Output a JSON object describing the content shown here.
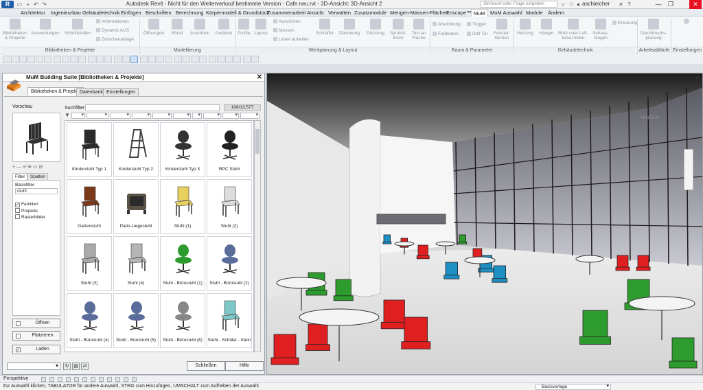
{
  "titlebar": {
    "app_logo": "R",
    "title": "Autodesk Revit - Nicht für den Weiterverkauf bestimmte Version -   Cafe neu.rvt - 3D-Ansicht: 3D-Ansicht 2",
    "search_placeholder": "Stichwort oder Frage eingeben",
    "user": "aschleicher"
  },
  "ribbon": {
    "tabs": [
      "Architektur",
      "Ingenieurbau",
      "Gebäudetechnik",
      "Einfügen",
      "Beschriften",
      "Berechnung",
      "Körpermodell & Grundstück",
      "Zusammenarbeit",
      "Ansicht",
      "Verwalten",
      "Zusatzmodule",
      "Mengen-Massen-Flächen",
      "Enscape™",
      "MuM",
      "MuM Auswahl",
      "Module",
      "Ändern"
    ],
    "active_tab": "MuM",
    "buttons": {
      "bibliotheken": "Bibliotheken & Projekte",
      "auswertungen": "Auswertungen",
      "schnittstellen": "Schnittstellen",
      "informationen": "Informationen",
      "dynamic_aus": "Dynamic AUS",
      "zwischenablage": "Zwischenablage",
      "oeffnungen": "Öffnungen",
      "wand": "Wand",
      "anordnen": "Anordnen",
      "gelaende": "Gelände",
      "profile": "Profile",
      "layout": "Layout",
      "aussichten": "Aussichten",
      "messen": "Messen",
      "linien_aufteilen": "Linien aufteilen",
      "schraffur": "Schraffur",
      "daemmung": "Dämmung",
      "dichtung": "Dichtung",
      "symbol_linien": "Symbol-linien",
      "text_an_flaeche": "Text an Fläche",
      "abwicklung": "Abwicklung",
      "fussboden": "Fußboden",
      "trigger": "Trigger",
      "din_tuer": "DIN Tür",
      "fensterflaechen": "Fenster-flächen",
      "heizung": "Heizung",
      "haenger": "Hänger",
      "rohr_luftkanal": "Rohr oder Luft-kanal teilen",
      "schussfaengen": "Schuss-fängen",
      "kreuzung": "Kreuzung",
      "durchbruchsplanung": "Durchbruchs-planung"
    },
    "panels": [
      "Bibliotheken & Projekte",
      "Modellierung",
      "Werkplanung & Layout",
      "Raum & Parameter",
      "Gebäudetechnik",
      "Arbeitsabläufe",
      "Einstellungen"
    ]
  },
  "colors": {
    "accent": "#1f5da6",
    "chair_red": "#e02020",
    "chair_green": "#2e9b2e",
    "chair_blue": "#1e8fc2",
    "close_red": "#e81123"
  },
  "mum": {
    "title": "MuM Building Suite [Bibliotheken & Projekte]",
    "tabs": [
      "Bibliotheken & Projekte",
      "Datenbank",
      "Einstellungen"
    ],
    "preview_label": "Vorschau",
    "preview_tools": "+ — +⁄ ⊕ ▭ ⊟",
    "filter_tabs": [
      "Filter",
      "Spalten"
    ],
    "basisfilter_label": "Basisfilter",
    "basisfilter_value": "stuhl",
    "checkboxes": [
      {
        "label": "Familien",
        "checked": true
      },
      {
        "label": "Projekte",
        "checked": false
      },
      {
        "label": "Rasterbilder",
        "checked": false
      }
    ],
    "actions": [
      {
        "label": "Öffnen",
        "checked": false
      },
      {
        "label": "Platzieren",
        "checked": false
      },
      {
        "label": "Laden",
        "checked": true
      }
    ],
    "search_label": "Suchfilter",
    "count": "108/13.577",
    "items": [
      {
        "name": "Kinderstuhl Typ 1",
        "kind": "chair-black"
      },
      {
        "name": "Kinderstuhl Typ 2",
        "kind": "highchair"
      },
      {
        "name": "Kinderstuhl Typ 3",
        "kind": "office-black"
      },
      {
        "name": "RPC Stuhl",
        "kind": "office-mesh"
      },
      {
        "name": "Gartenstuhl",
        "kind": "garden"
      },
      {
        "name": "Patio-Liegestuhl",
        "kind": "patio"
      },
      {
        "name": "Stuhl (1)",
        "kind": "yellow-chair"
      },
      {
        "name": "Stuhl (2)",
        "kind": "wire-chair"
      },
      {
        "name": "Stuhl (3)",
        "kind": "grey-chair"
      },
      {
        "name": "Stuhl (4)",
        "kind": "grey-chair2"
      },
      {
        "name": "Stuhl - Bürostuhl (1)",
        "kind": "office-green"
      },
      {
        "name": "Stuhl - Bürostuhl (2)",
        "kind": "office-blue"
      },
      {
        "name": "Stuhl - Bürostuhl (4)",
        "kind": "office-blue"
      },
      {
        "name": "Stuhl - Bürostuhl (5)",
        "kind": "office-blue"
      },
      {
        "name": "Stuhl - Bürostuhl (6)",
        "kind": "office-grey"
      },
      {
        "name": "Stuhl - Schüler - Klein",
        "kind": "school-teal"
      }
    ],
    "close_button": "Schließen",
    "help_button": "Hilfe"
  },
  "view3d": {
    "viewcube_label": "HINTEN"
  },
  "viewbar": {
    "mode": "Perspektive"
  },
  "statusbar": {
    "text": "Zur Auswahl klicken, TABULATOR für andere Auswahl, STRG zum Hinzufügen, UMSCHALT zum Aufheben der Auswahl.",
    "base": "Basisvorlage"
  }
}
